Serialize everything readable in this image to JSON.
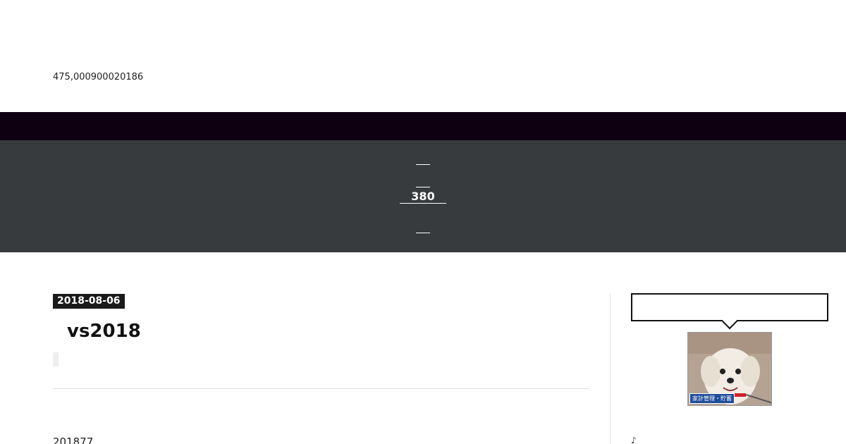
{
  "header": {
    "site_description": "475,000900020186"
  },
  "nav": {
    "items": [
      {
        "label": ""
      },
      {
        "label": ""
      },
      {
        "label": "380　　"
      },
      {
        "label": ""
      },
      {
        "label": ""
      }
    ]
  },
  "post": {
    "date": "2018-08-06",
    "title": "vs2018",
    "lead": "201877"
  },
  "sidebar": {
    "bubble_text": "",
    "image_caption": "家計管理・貯蓄",
    "icon": "music-note-icon",
    "icon_glyph": "♪"
  },
  "colors": {
    "topbar": "#0f0011",
    "navband": "#373b3d",
    "date_badge": "#1a1a1a",
    "caption_bg": "#1f4d9a"
  }
}
